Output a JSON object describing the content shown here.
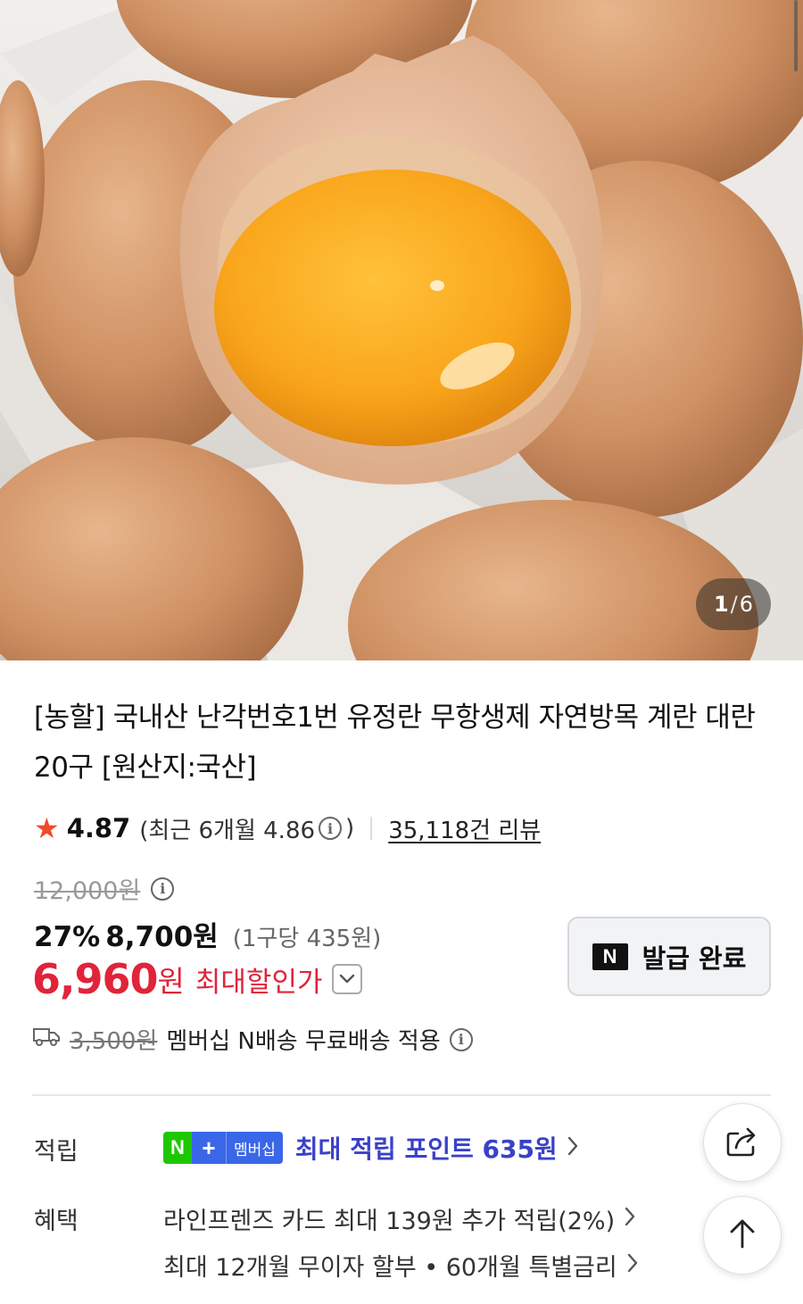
{
  "gallery": {
    "current_page": "1",
    "separator": "/",
    "total_pages": "6"
  },
  "product": {
    "title": "[농할] 국내산 난각번호1번 유정란 무항생제 자연방목 계란 대란 20구 [원산지:국산]"
  },
  "rating": {
    "score": "4.87",
    "recent_prefix": "(최근 6개월 4.86",
    "recent_suffix": ")",
    "review_count": "35,118건 리뷰"
  },
  "price": {
    "original": "12,000원",
    "discount_rate": "27%",
    "discounted": "8,700원",
    "unit_price": "(1구당 435원)",
    "max_discount_value": "6,960",
    "max_discount_currency": "원",
    "max_discount_label": "최대할인가"
  },
  "coupon": {
    "logo": "N",
    "label": "발급 완료"
  },
  "shipping": {
    "original_fee": "3,500원",
    "description": "멤버십 N배송 무료배송 적용"
  },
  "points": {
    "label": "적립",
    "badge_n": "N",
    "badge_plus": "+",
    "badge_membership": "멤버십",
    "text": "최대 적립 포인트 635원"
  },
  "benefits": {
    "label": "혜택",
    "items": [
      "라인프렌즈 카드 최대 139원 추가 적립(2%)",
      "최대 12개월 무이자 할부 • 60개월 특별금리"
    ]
  },
  "icons": {
    "star": "star-icon",
    "info": "info-icon",
    "truck": "truck-icon",
    "share": "share-icon",
    "up": "arrow-up-icon"
  },
  "colors": {
    "accent_red": "#e0243a",
    "star": "#f04a2a",
    "points_blue": "#3a41c9",
    "naver_green": "#1ec800"
  }
}
